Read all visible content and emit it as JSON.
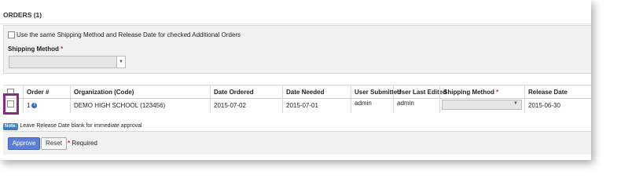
{
  "section": {
    "title": "ORDERS (1)"
  },
  "bulk": {
    "checkbox_label": "Use the same Shipping Method and Release Date for checked Additional Orders",
    "shipping_method_label": "Shipping Method",
    "required_marker": "*",
    "shipping_method_value": ""
  },
  "table": {
    "headers": {
      "order": "Order #",
      "organization": "Organization (Code)",
      "date_ordered": "Date Ordered",
      "date_needed": "Date Needed",
      "user_submitted": "User Submitted",
      "user_last_edited": "User Last Edited",
      "shipping_method": "Shipping Method",
      "release_date": "Release Date"
    },
    "rows": [
      {
        "order": "1",
        "organization": "DEMO HIGH SCHOOL (123456)",
        "date_ordered": "2015-07-02",
        "date_needed": "2015-07-01",
        "user_submitted": "admin",
        "user_last_edited": "admin",
        "shipping_method": "",
        "release_date": "2015-06-30"
      }
    ]
  },
  "note": {
    "badge": "Note:",
    "text": "Leave Release Date blank for immediate approval"
  },
  "footer": {
    "approve_label": "Approve",
    "reset_label": "Reset",
    "required_text": "Required",
    "required_marker": "*"
  },
  "icons": {
    "info": "info-icon",
    "dropdown": "chevron-down-icon"
  },
  "colors": {
    "approve_button": "#5b7fd8",
    "highlight_border": "#8b2a84",
    "required": "#d9232d",
    "info_icon": "#2a6fc9"
  }
}
